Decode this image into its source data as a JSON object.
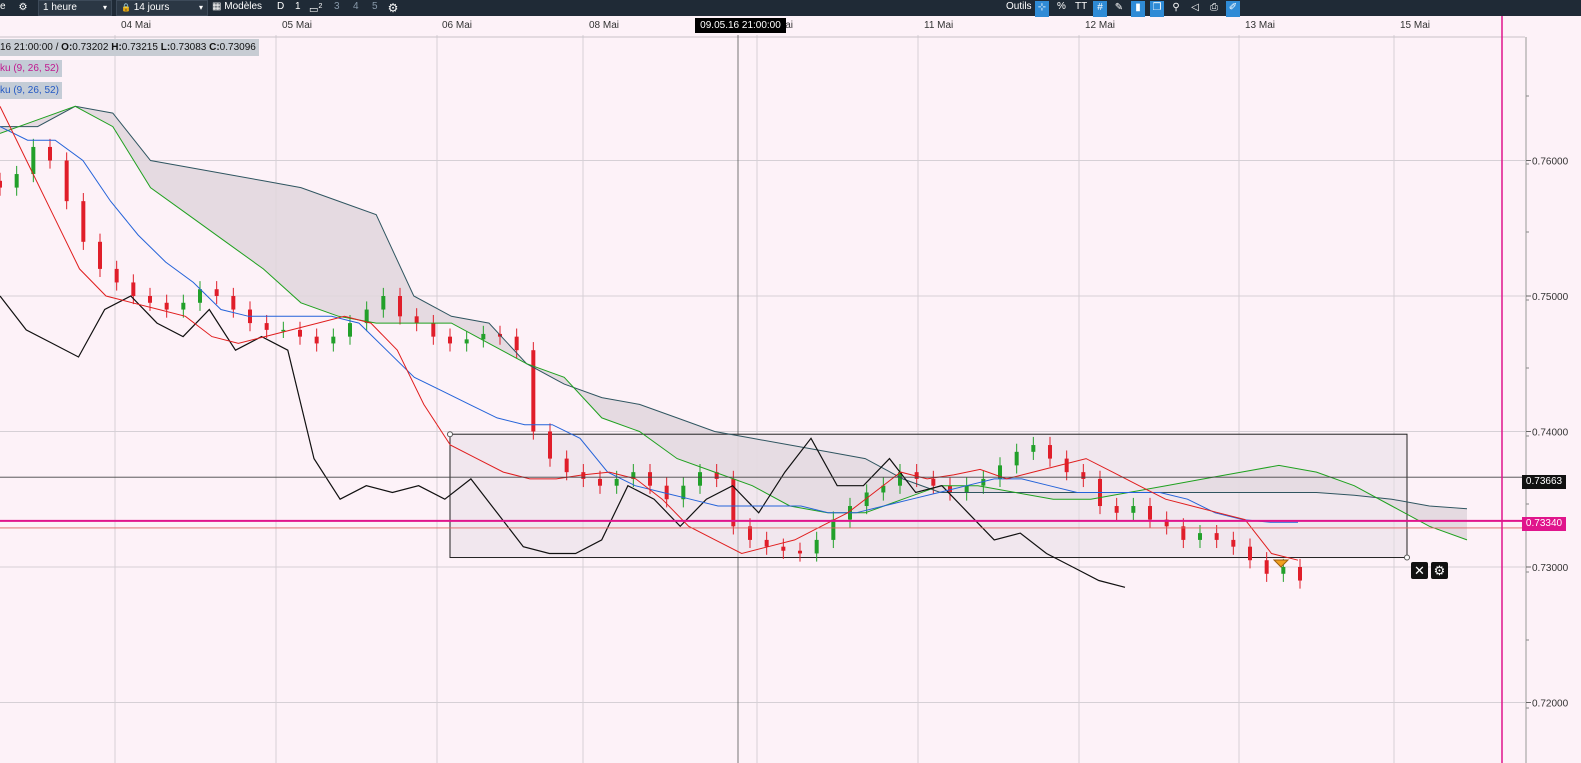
{
  "toolbar": {
    "left_fragment": "e",
    "interval": "1 heure",
    "range": "14 jours",
    "templates_label": "Modèles",
    "period_d": "D",
    "layout_1": "1",
    "layout_superscript": "2",
    "layout_3": "3",
    "layout_4": "4",
    "layout_5": "5",
    "tools_label": "Outils",
    "percent_label": "%",
    "text_label": "TT",
    "icons": [
      "gear-icon",
      "lock-icon",
      "calendar-icon",
      "layout-icon",
      "settings-icon",
      "crosshair-icon",
      "grid-icon",
      "candle-icon",
      "layers-icon",
      "draw-icon",
      "eraser-icon",
      "print-icon",
      "brush-icon"
    ]
  },
  "info": {
    "ohlc_prefix": "16 21:00:00 / ",
    "o_label": "O:",
    "o_value": "0.73202",
    "h_label": "H:",
    "h_value": "0.73215",
    "l_label": "L:",
    "l_value": "0.73083",
    "c_label": "C:",
    "c_value": "0.73096",
    "indicator1": "ku (9, 26, 52)",
    "indicator2": "ku (9, 26, 52)"
  },
  "crosshair_label": "09.05.16 21:00:00",
  "price_boxes": {
    "last": "0.73663",
    "line": "0.73340"
  },
  "buttons": {
    "close": "✕",
    "settings": "⚙"
  },
  "colors": {
    "background": "#fdf2f8",
    "up_candle": "#22a02a",
    "down_candle": "#e01e2a",
    "tenkan": "#e01e1e",
    "kijun": "#2463d9",
    "chikou": "#111111",
    "senkou_a": "#1fa11f",
    "senkou_b": "#2f5560",
    "cloud": "#e0d6dd",
    "hline": "#e0158c"
  },
  "chart_data": {
    "type": "candlestick",
    "x_tick_labels": [
      "04 Mai",
      "05 Mai",
      "06 Mai",
      "08 Mai",
      "09 Mai",
      "11 Mai",
      "12 Mai",
      "13 Mai",
      "15 Mai"
    ],
    "y_tick_labels": [
      "0.76000",
      "0.75000",
      "0.74000",
      "0.73000",
      "0.72000"
    ],
    "ylim": [
      0.7175,
      0.764
    ],
    "horizontal_lines": [
      0.7334,
      0.73663
    ],
    "rectangle": {
      "x_start": "06 Mai",
      "x_end": "15 Mai",
      "y_top": 0.7398,
      "y_bottom": 0.7307
    },
    "series": [
      {
        "name": "tenkan",
        "values": [
          0.764,
          0.76,
          0.756,
          0.752,
          0.75,
          0.7495,
          0.749,
          0.7485,
          0.747,
          0.7465,
          0.747,
          0.7475,
          0.748,
          0.7485,
          0.748,
          0.746,
          0.742,
          0.739,
          0.738,
          0.737,
          0.7365,
          0.7365,
          0.7368,
          0.737,
          0.7365,
          0.735,
          0.733,
          0.732,
          0.731,
          0.7315,
          0.732,
          0.733,
          0.734,
          0.7355,
          0.737,
          0.7365,
          0.7368,
          0.7372,
          0.7365,
          0.737,
          0.7375,
          0.738,
          0.737,
          0.736,
          0.735,
          0.7345,
          0.734,
          0.7335,
          0.731,
          0.7305
        ]
      },
      {
        "name": "kijun",
        "values": [
          0.7625,
          0.7615,
          0.7615,
          0.76,
          0.757,
          0.7545,
          0.7525,
          0.751,
          0.749,
          0.7485,
          0.7485,
          0.7485,
          0.7485,
          0.748,
          0.746,
          0.744,
          0.743,
          0.742,
          0.741,
          0.7405,
          0.7405,
          0.7395,
          0.737,
          0.736,
          0.7355,
          0.735,
          0.7345,
          0.7345,
          0.7345,
          0.7345,
          0.734,
          0.734,
          0.7345,
          0.735,
          0.7355,
          0.736,
          0.7365,
          0.7365,
          0.736,
          0.7355,
          0.7355,
          0.7355,
          0.7355,
          0.735,
          0.734,
          0.7335,
          0.7333,
          0.7333
        ]
      },
      {
        "name": "chikou",
        "values": [
          0.75,
          0.7475,
          0.7465,
          0.7455,
          0.749,
          0.75,
          0.748,
          0.747,
          0.749,
          0.746,
          0.747,
          0.746,
          0.738,
          0.735,
          0.736,
          0.7355,
          0.736,
          0.735,
          0.7365,
          0.734,
          0.7315,
          0.731,
          0.731,
          0.732,
          0.736,
          0.735,
          0.733,
          0.735,
          0.736,
          0.734,
          0.737,
          0.7395,
          0.736,
          0.736,
          0.738,
          0.7355,
          0.736,
          0.734,
          0.732,
          0.7325,
          0.731,
          0.73,
          0.729,
          0.7285
        ]
      },
      {
        "name": "senkou_a",
        "values": [
          0.762,
          0.763,
          0.764,
          0.7625,
          0.758,
          0.756,
          0.754,
          0.752,
          0.7495,
          0.7485,
          0.748,
          0.748,
          0.748,
          0.7465,
          0.745,
          0.744,
          0.741,
          0.74,
          0.738,
          0.737,
          0.736,
          0.7345,
          0.734,
          0.734,
          0.735,
          0.736,
          0.736,
          0.7355,
          0.735,
          0.735,
          0.7355,
          0.736,
          0.7365,
          0.737,
          0.7375,
          0.737,
          0.736,
          0.7345,
          0.733,
          0.732
        ]
      },
      {
        "name": "senkou_b",
        "values": [
          0.7625,
          0.7625,
          0.764,
          0.7635,
          0.76,
          0.7595,
          0.759,
          0.7585,
          0.758,
          0.757,
          0.756,
          0.75,
          0.7485,
          0.748,
          0.745,
          0.7435,
          0.7425,
          0.742,
          0.741,
          0.74,
          0.7395,
          0.739,
          0.7385,
          0.738,
          0.7365,
          0.7355,
          0.7355,
          0.7355,
          0.7355,
          0.7355,
          0.7355,
          0.7355,
          0.7355,
          0.7355,
          0.7355,
          0.7355,
          0.7353,
          0.735,
          0.7345,
          0.7343
        ]
      },
      {
        "name": "candles_close",
        "values": [
          0.758,
          0.759,
          0.761,
          0.76,
          0.757,
          0.754,
          0.752,
          0.751,
          0.75,
          0.7495,
          0.749,
          0.7495,
          0.7505,
          0.75,
          0.749,
          0.748,
          0.7475,
          0.7475,
          0.747,
          0.7465,
          0.747,
          0.748,
          0.749,
          0.75,
          0.7485,
          0.748,
          0.747,
          0.7465,
          0.7468,
          0.7472,
          0.747,
          0.746,
          0.74,
          0.738,
          0.737,
          0.7365,
          0.736,
          0.7365,
          0.737,
          0.736,
          0.735,
          0.736,
          0.737,
          0.7365,
          0.733,
          0.732,
          0.7315,
          0.7312,
          0.731,
          0.732,
          0.7335,
          0.7345,
          0.7355,
          0.736,
          0.737,
          0.7365,
          0.736,
          0.7355,
          0.736,
          0.7365,
          0.7375,
          0.7385,
          0.739,
          0.738,
          0.737,
          0.7365,
          0.7345,
          0.734,
          0.7345,
          0.7335,
          0.733,
          0.732,
          0.7325,
          0.732,
          0.7315,
          0.7305,
          0.7295,
          0.73,
          0.729
        ]
      }
    ]
  }
}
